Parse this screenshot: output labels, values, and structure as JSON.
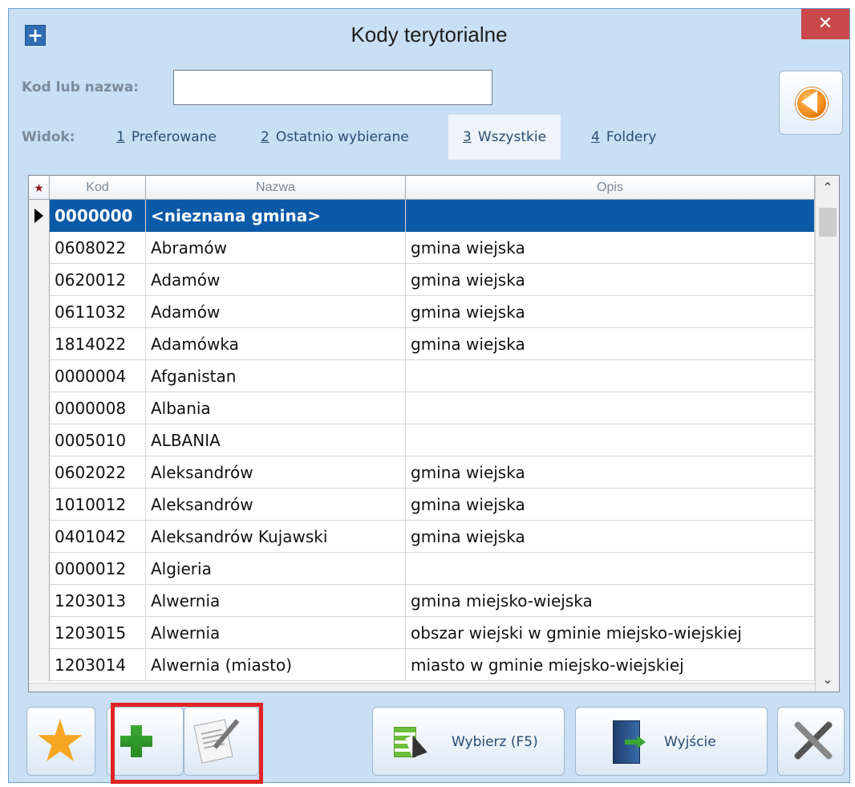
{
  "window": {
    "title": "Kody terytorialne",
    "close_symbol": "✕",
    "app_icon_symbol": "+"
  },
  "search": {
    "label": "Kod lub nazwa:",
    "value": ""
  },
  "view": {
    "label": "Widok:",
    "tabs": [
      {
        "key": "1",
        "label": "Preferowane"
      },
      {
        "key": "2",
        "label": "Ostatnio wybierane"
      },
      {
        "key": "3",
        "label": "Wszystkie",
        "active": true
      },
      {
        "key": "4",
        "label": "Foldery"
      }
    ]
  },
  "grid": {
    "columns": [
      "Kod",
      "Nazwa",
      "Opis"
    ],
    "star_symbol": "★",
    "rows": [
      {
        "kod": "0000000",
        "nazwa": "<nieznana gmina>",
        "opis": "",
        "selected": true
      },
      {
        "kod": "0608022",
        "nazwa": "Abramów",
        "opis": "gmina wiejska"
      },
      {
        "kod": "0620012",
        "nazwa": "Adamów",
        "opis": "gmina wiejska"
      },
      {
        "kod": "0611032",
        "nazwa": "Adamów",
        "opis": "gmina wiejska"
      },
      {
        "kod": "1814022",
        "nazwa": "Adamówka",
        "opis": "gmina wiejska"
      },
      {
        "kod": "0000004",
        "nazwa": "Afganistan",
        "opis": ""
      },
      {
        "kod": "0000008",
        "nazwa": "Albania",
        "opis": ""
      },
      {
        "kod": "0005010",
        "nazwa": "ALBANIA",
        "opis": ""
      },
      {
        "kod": "0602022",
        "nazwa": "Aleksandrów",
        "opis": "gmina wiejska"
      },
      {
        "kod": "1010012",
        "nazwa": "Aleksandrów",
        "opis": "gmina wiejska"
      },
      {
        "kod": "0401042",
        "nazwa": "Aleksandrów Kujawski",
        "opis": "gmina wiejska"
      },
      {
        "kod": "0000012",
        "nazwa": "Algieria",
        "opis": ""
      },
      {
        "kod": "1203013",
        "nazwa": "Alwernia",
        "opis": "gmina miejsko-wiejska"
      },
      {
        "kod": "1203015",
        "nazwa": "Alwernia",
        "opis": "obszar wiejski w gminie miejsko-wiejskiej"
      },
      {
        "kod": "1203014",
        "nazwa": "Alwernia (miasto)",
        "opis": "miasto w gminie miejsko-wiejskiej"
      }
    ]
  },
  "toolbar": {
    "select_label": "Wybierz (F5)",
    "exit_label": "Wyjście"
  },
  "colors": {
    "selection": "#0b5aa8",
    "window_bg": "#c9dff4",
    "highlight": "#e02424"
  }
}
